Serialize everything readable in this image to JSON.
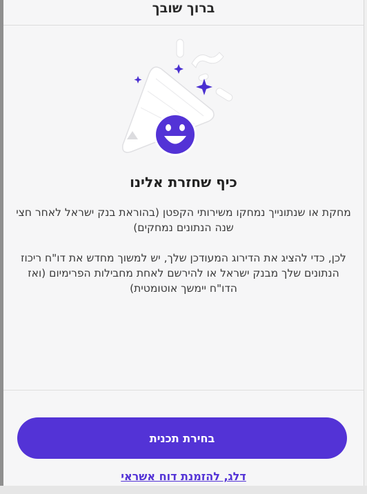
{
  "header": {
    "title": "ברוך שובך"
  },
  "content": {
    "title": "כיף שחזרת אלינו",
    "paragraph_1": "מחקת או שנתונייך נמחקו משירותי הקפטן (בהוראת בנק ישראל לאחר חצי שנה הנתונים נמחקים)",
    "paragraph_2": "לכן, כדי להציג את הדירוג המעודכן שלך, יש למשוך מחדש את דו\"ח ריכוז הנתונים שלך מבנק ישראל או להירשם לאחת מחבילות הפרימיום (ואז הדו\"ח יימשך אוטומטית)"
  },
  "actions": {
    "primary_label": "בחירת תכנית",
    "secondary_link": "דלג, להזמנת דוח אשראי"
  },
  "icons": {
    "illustration": "party-popper-smiley-icon"
  },
  "colors": {
    "accent": "#5333d6",
    "background": "#f6f6f7",
    "text": "#222222"
  }
}
